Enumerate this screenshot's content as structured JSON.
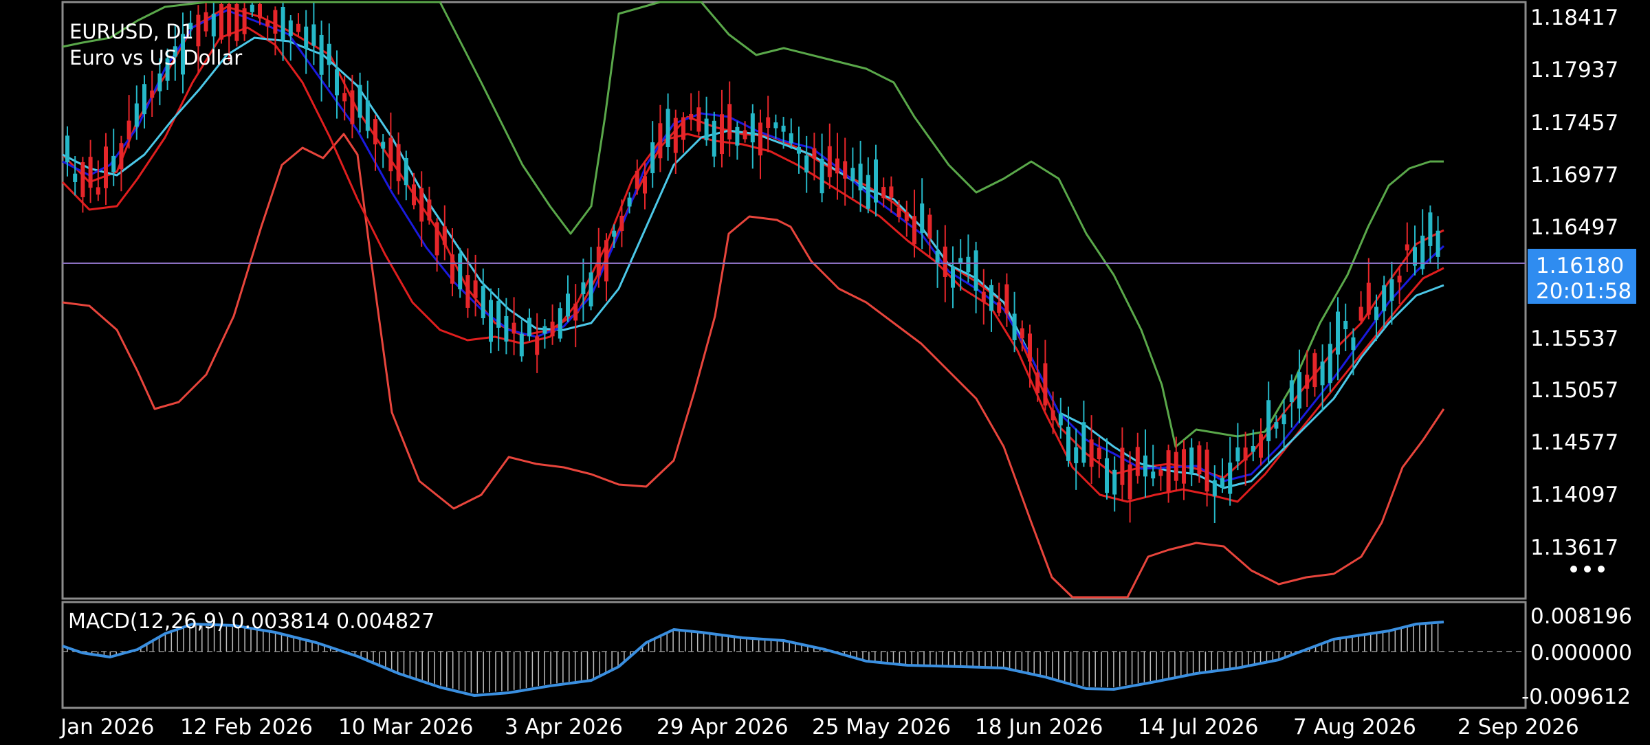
{
  "symbol": {
    "title": "EURUSD, D1",
    "description": "Euro vs US Dollar"
  },
  "price_axis": {
    "labels": [
      "1.18417",
      "1.17937",
      "1.17457",
      "1.16977",
      "1.16497",
      "1.15537",
      "1.15057",
      "1.14577",
      "1.14097",
      "1.13617"
    ]
  },
  "current_price": {
    "value": "1.16180",
    "countdown": "20:01:58",
    "level": 1.1618
  },
  "indicator": {
    "label": "MACD(12,26,9) 0.003814 0.004827",
    "axis_labels": [
      "0.008196",
      "0.000000",
      "-0.009612"
    ]
  },
  "time_axis": {
    "labels": [
      "Jan 2026",
      "12 Feb 2026",
      "10 Mar 2026",
      "3 Apr 2026",
      "29 Apr 2026",
      "25 May 2026",
      "18 Jun 2026",
      "14 Jul 2026",
      "7 Aug 2026",
      "2 Sep 2026"
    ]
  },
  "colors": {
    "background": "#000000",
    "bull_candle": "#26b8c8",
    "bear_candle": "#e6262a",
    "bollinger_upper": "#5aa84a",
    "bollinger_lower": "#e8453c",
    "ma_blue": "#1a1adf",
    "ma_cyan": "#4cc8e8",
    "ma_red": "#e01e1e",
    "macd_signal": "#3a8fe0",
    "price_badge": "#2f8cf0",
    "price_line": "#8a6fc0"
  },
  "menu": {
    "icon": "more-dots-icon"
  }
}
